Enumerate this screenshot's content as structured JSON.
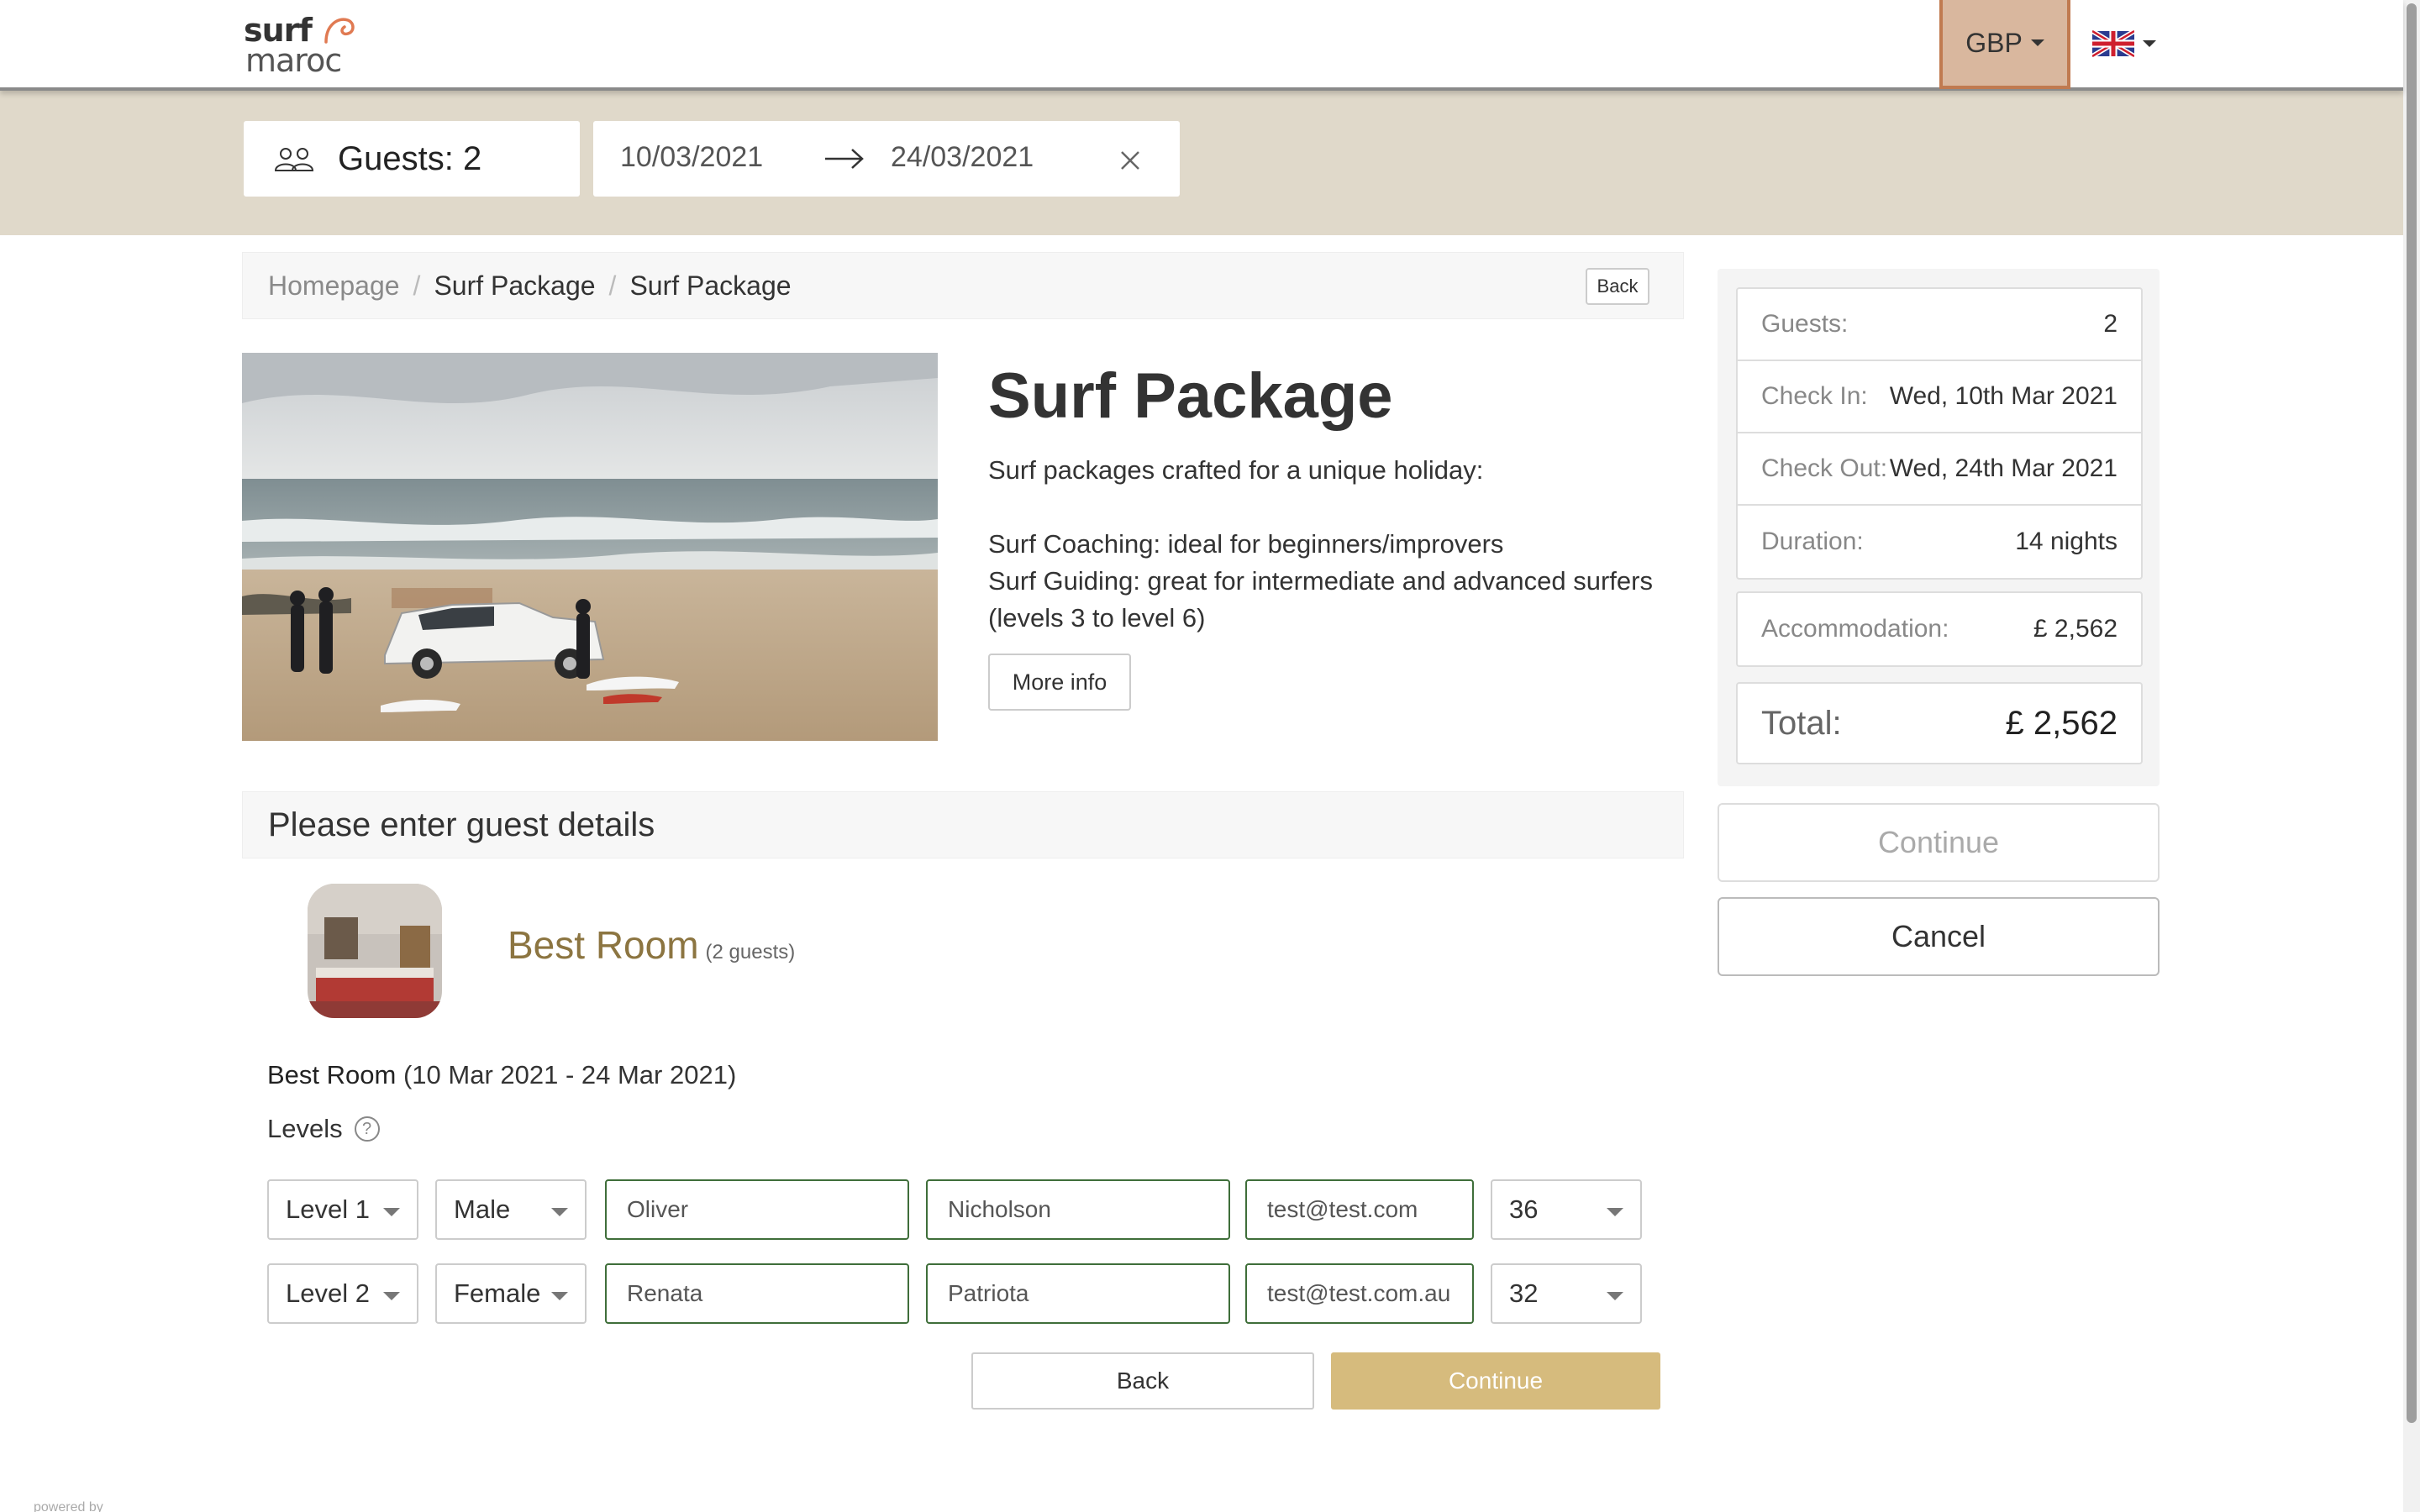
{
  "header": {
    "logo_top": "surf",
    "logo_bottom": "maroc",
    "currency": "GBP",
    "language_icon": "uk-flag-icon"
  },
  "search": {
    "guests_label": "Guests: 2",
    "date_from": "10/03/2021",
    "date_to": "24/03/2021"
  },
  "breadcrumb": {
    "items": [
      "Homepage",
      "Surf Package",
      "Surf Package"
    ],
    "back_label": "Back"
  },
  "package": {
    "title": "Surf Package",
    "intro": "Surf packages crafted for a unique holiday:",
    "line1": "Surf Coaching: ideal for beginners/improvers",
    "line2": "Surf Guiding: great for intermediate and advanced surfers (levels 3 to level 6)",
    "more_info_label": "More info"
  },
  "guest_details": {
    "heading": "Please enter guest details",
    "room_name": "Best Room",
    "room_guests": "(2 guests)",
    "room_dates_name": "Best Room",
    "room_dates_range": " (10 Mar 2021 - 24 Mar 2021)",
    "levels_label": "Levels",
    "guests": [
      {
        "level": "Level 1",
        "gender": "Male",
        "first_name": "Oliver",
        "last_name": "Nicholson",
        "email": "test@test.com",
        "age": "36"
      },
      {
        "level": "Level 2",
        "gender": "Female",
        "first_name": "Renata",
        "last_name": "Patriota",
        "email": "test@test.com.au",
        "age": "32"
      }
    ],
    "back_label": "Back",
    "continue_label": "Continue"
  },
  "summary": {
    "rows": [
      {
        "label": "Guests:",
        "value": "2"
      },
      {
        "label": "Check In:",
        "value": "Wed, 10th Mar 2021"
      },
      {
        "label": "Check Out:",
        "value": "Wed, 24th Mar 2021"
      },
      {
        "label": "Duration:",
        "value": "14 nights"
      }
    ],
    "accommodation_label": "Accommodation:",
    "accommodation_value": "£ 2,562",
    "total_label": "Total:",
    "total_value": "£ 2,562",
    "continue_label": "Continue",
    "cancel_label": "Cancel"
  },
  "footer": {
    "powered_by": "powered by"
  },
  "colors": {
    "brand_gold": "#d6bb7d",
    "room_name": "#8c7541",
    "search_strip": "#e0d9ca",
    "currency_bg": "#d9b79e",
    "input_border": "#3f6e3a"
  }
}
